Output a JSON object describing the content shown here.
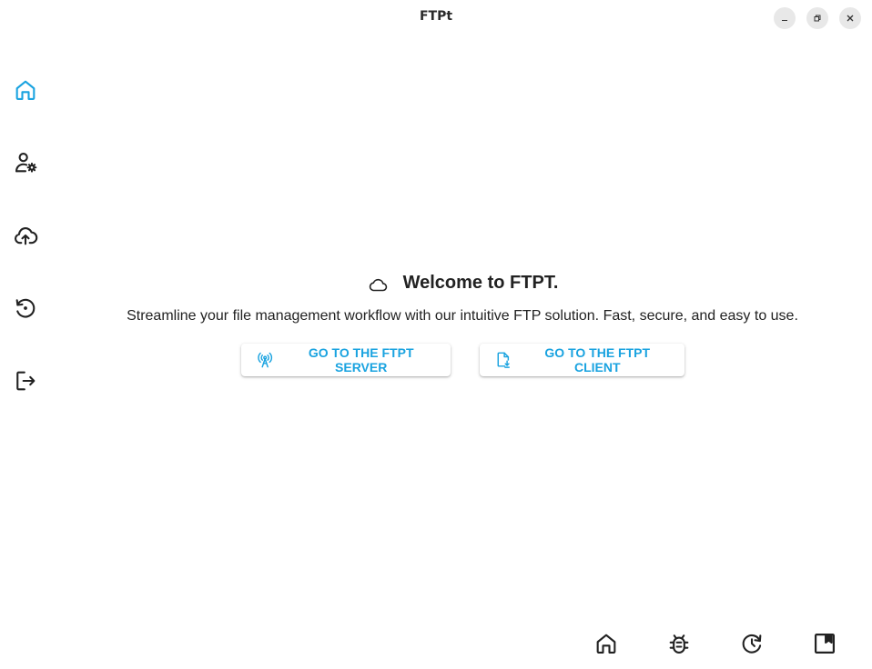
{
  "window": {
    "title": "FTPt",
    "minimize_icon": "minimize-icon",
    "maximize_icon": "maximize-icon",
    "close_icon": "close-icon"
  },
  "colors": {
    "accent": "#1aa3e0",
    "text": "#222222",
    "background": "#ffffff"
  },
  "sidebar": {
    "items": [
      {
        "id": "home",
        "icon": "home-icon",
        "active": true
      },
      {
        "id": "user-settings",
        "icon": "user-gear-icon",
        "active": false
      },
      {
        "id": "upload",
        "icon": "cloud-upload-icon",
        "active": false
      },
      {
        "id": "history",
        "icon": "history-icon",
        "active": false
      },
      {
        "id": "logout",
        "icon": "logout-icon",
        "active": false
      }
    ]
  },
  "main": {
    "welcome_icon": "cloud-icon",
    "welcome_title": "Welcome to FTPT.",
    "subtitle": "Streamline your file management workflow with our intuitive FTP solution. Fast, secure, and easy to use.",
    "buttons": {
      "server": {
        "label": "GO TO THE FTPT SERVER",
        "icon": "broadcast-tower-icon"
      },
      "client": {
        "label": "GO TO THE FTPT CLIENT",
        "icon": "file-download-icon"
      }
    }
  },
  "bottom_toolbar": {
    "items": [
      {
        "id": "home",
        "icon": "home-icon"
      },
      {
        "id": "debug",
        "icon": "bug-icon"
      },
      {
        "id": "refresh",
        "icon": "history-refresh-icon"
      },
      {
        "id": "docs",
        "icon": "bookmark-book-icon"
      }
    ]
  }
}
